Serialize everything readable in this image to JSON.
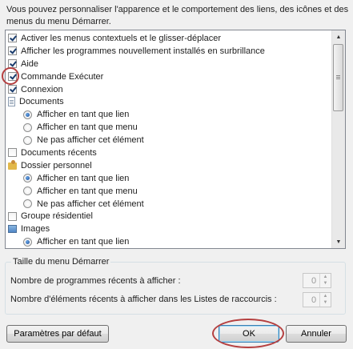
{
  "intro_text": "Vous pouvez personnaliser l'apparence et le comportement des liens, des icônes et des menus du menu Démarrer.",
  "list_items": [
    {
      "kind": "checkbox",
      "checked": true,
      "label": "Activer les menus contextuels et le glisser-déplacer",
      "level": 0
    },
    {
      "kind": "checkbox",
      "checked": true,
      "label": "Afficher les programmes nouvellement installés en surbrillance",
      "level": 0
    },
    {
      "kind": "checkbox",
      "checked": true,
      "label": "Aide",
      "level": 0
    },
    {
      "kind": "checkbox",
      "checked": true,
      "label": "Commande Exécuter",
      "level": 0
    },
    {
      "kind": "checkbox",
      "checked": true,
      "label": "Connexion",
      "level": 0
    },
    {
      "kind": "doc-icon",
      "label": "Documents",
      "level": 0
    },
    {
      "kind": "radio",
      "checked": true,
      "label": "Afficher en tant que lien",
      "level": 1
    },
    {
      "kind": "radio",
      "checked": false,
      "label": "Afficher en tant que menu",
      "level": 1
    },
    {
      "kind": "radio",
      "checked": false,
      "label": "Ne pas afficher cet élément",
      "level": 1
    },
    {
      "kind": "checkbox",
      "checked": false,
      "label": "Documents récents",
      "level": 0
    },
    {
      "kind": "folder-icon",
      "label": "Dossier personnel",
      "level": 0
    },
    {
      "kind": "radio",
      "checked": true,
      "label": "Afficher en tant que lien",
      "level": 1
    },
    {
      "kind": "radio",
      "checked": false,
      "label": "Afficher en tant que menu",
      "level": 1
    },
    {
      "kind": "radio",
      "checked": false,
      "label": "Ne pas afficher cet élément",
      "level": 1
    },
    {
      "kind": "checkbox",
      "checked": false,
      "label": "Groupe résidentiel",
      "level": 0
    },
    {
      "kind": "image-icon",
      "label": "Images",
      "level": 0
    },
    {
      "kind": "radio",
      "checked": true,
      "label": "Afficher en tant que lien",
      "level": 1
    }
  ],
  "size_group": {
    "title": "Taille du menu Démarrer",
    "recent_programs_label": "Nombre de programmes récents à afficher :",
    "recent_programs_value": "0",
    "recent_items_label": "Nombre d'éléments récents à afficher dans les Listes de raccourcis :",
    "recent_items_value": "0"
  },
  "buttons": {
    "defaults": "Paramètres par défaut",
    "ok": "OK",
    "cancel": "Annuler"
  },
  "icons": {
    "scroll_up": "▲",
    "scroll_down": "▼",
    "spin_up": "▲",
    "spin_down": "▼"
  },
  "colors": {
    "highlight_circle": "#b54040",
    "checkmark": "#1b3d6e"
  }
}
